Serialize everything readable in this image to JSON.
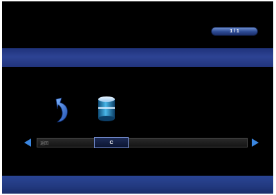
{
  "header": {
    "page_indicator": "1 / 1"
  },
  "icons": {
    "back": "return-arrow-icon",
    "device": "disk-drive-icon",
    "nav_left": "left-arrow-icon",
    "nav_right": "right-arrow-icon"
  },
  "device_bar": {
    "items": [
      {
        "label": "返回"
      },
      {
        "label": "C"
      }
    ],
    "selected_index": 1
  },
  "colors": {
    "background": "#000000",
    "band": "#2d4394",
    "accent": "#3a86e0",
    "selection_border": "#6f87c8"
  }
}
